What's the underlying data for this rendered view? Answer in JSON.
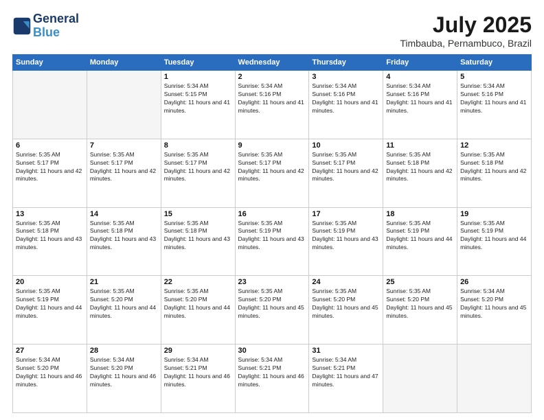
{
  "header": {
    "logo_line1": "General",
    "logo_line2": "Blue",
    "month_title": "July 2025",
    "location": "Timbauba, Pernambuco, Brazil"
  },
  "days_of_week": [
    "Sunday",
    "Monday",
    "Tuesday",
    "Wednesday",
    "Thursday",
    "Friday",
    "Saturday"
  ],
  "weeks": [
    [
      {
        "day": "",
        "empty": true
      },
      {
        "day": "",
        "empty": true
      },
      {
        "day": "1",
        "sunrise": "5:34 AM",
        "sunset": "5:15 PM",
        "daylight": "11 hours and 41 minutes."
      },
      {
        "day": "2",
        "sunrise": "5:34 AM",
        "sunset": "5:16 PM",
        "daylight": "11 hours and 41 minutes."
      },
      {
        "day": "3",
        "sunrise": "5:34 AM",
        "sunset": "5:16 PM",
        "daylight": "11 hours and 41 minutes."
      },
      {
        "day": "4",
        "sunrise": "5:34 AM",
        "sunset": "5:16 PM",
        "daylight": "11 hours and 41 minutes."
      },
      {
        "day": "5",
        "sunrise": "5:34 AM",
        "sunset": "5:16 PM",
        "daylight": "11 hours and 41 minutes."
      }
    ],
    [
      {
        "day": "6",
        "sunrise": "5:35 AM",
        "sunset": "5:17 PM",
        "daylight": "11 hours and 42 minutes."
      },
      {
        "day": "7",
        "sunrise": "5:35 AM",
        "sunset": "5:17 PM",
        "daylight": "11 hours and 42 minutes."
      },
      {
        "day": "8",
        "sunrise": "5:35 AM",
        "sunset": "5:17 PM",
        "daylight": "11 hours and 42 minutes."
      },
      {
        "day": "9",
        "sunrise": "5:35 AM",
        "sunset": "5:17 PM",
        "daylight": "11 hours and 42 minutes."
      },
      {
        "day": "10",
        "sunrise": "5:35 AM",
        "sunset": "5:17 PM",
        "daylight": "11 hours and 42 minutes."
      },
      {
        "day": "11",
        "sunrise": "5:35 AM",
        "sunset": "5:18 PM",
        "daylight": "11 hours and 42 minutes."
      },
      {
        "day": "12",
        "sunrise": "5:35 AM",
        "sunset": "5:18 PM",
        "daylight": "11 hours and 42 minutes."
      }
    ],
    [
      {
        "day": "13",
        "sunrise": "5:35 AM",
        "sunset": "5:18 PM",
        "daylight": "11 hours and 43 minutes."
      },
      {
        "day": "14",
        "sunrise": "5:35 AM",
        "sunset": "5:18 PM",
        "daylight": "11 hours and 43 minutes."
      },
      {
        "day": "15",
        "sunrise": "5:35 AM",
        "sunset": "5:18 PM",
        "daylight": "11 hours and 43 minutes."
      },
      {
        "day": "16",
        "sunrise": "5:35 AM",
        "sunset": "5:19 PM",
        "daylight": "11 hours and 43 minutes."
      },
      {
        "day": "17",
        "sunrise": "5:35 AM",
        "sunset": "5:19 PM",
        "daylight": "11 hours and 43 minutes."
      },
      {
        "day": "18",
        "sunrise": "5:35 AM",
        "sunset": "5:19 PM",
        "daylight": "11 hours and 44 minutes."
      },
      {
        "day": "19",
        "sunrise": "5:35 AM",
        "sunset": "5:19 PM",
        "daylight": "11 hours and 44 minutes."
      }
    ],
    [
      {
        "day": "20",
        "sunrise": "5:35 AM",
        "sunset": "5:19 PM",
        "daylight": "11 hours and 44 minutes."
      },
      {
        "day": "21",
        "sunrise": "5:35 AM",
        "sunset": "5:20 PM",
        "daylight": "11 hours and 44 minutes."
      },
      {
        "day": "22",
        "sunrise": "5:35 AM",
        "sunset": "5:20 PM",
        "daylight": "11 hours and 44 minutes."
      },
      {
        "day": "23",
        "sunrise": "5:35 AM",
        "sunset": "5:20 PM",
        "daylight": "11 hours and 45 minutes."
      },
      {
        "day": "24",
        "sunrise": "5:35 AM",
        "sunset": "5:20 PM",
        "daylight": "11 hours and 45 minutes."
      },
      {
        "day": "25",
        "sunrise": "5:35 AM",
        "sunset": "5:20 PM",
        "daylight": "11 hours and 45 minutes."
      },
      {
        "day": "26",
        "sunrise": "5:34 AM",
        "sunset": "5:20 PM",
        "daylight": "11 hours and 45 minutes."
      }
    ],
    [
      {
        "day": "27",
        "sunrise": "5:34 AM",
        "sunset": "5:20 PM",
        "daylight": "11 hours and 46 minutes."
      },
      {
        "day": "28",
        "sunrise": "5:34 AM",
        "sunset": "5:20 PM",
        "daylight": "11 hours and 46 minutes."
      },
      {
        "day": "29",
        "sunrise": "5:34 AM",
        "sunset": "5:21 PM",
        "daylight": "11 hours and 46 minutes."
      },
      {
        "day": "30",
        "sunrise": "5:34 AM",
        "sunset": "5:21 PM",
        "daylight": "11 hours and 46 minutes."
      },
      {
        "day": "31",
        "sunrise": "5:34 AM",
        "sunset": "5:21 PM",
        "daylight": "11 hours and 47 minutes."
      },
      {
        "day": "",
        "empty": true
      },
      {
        "day": "",
        "empty": true
      }
    ]
  ]
}
